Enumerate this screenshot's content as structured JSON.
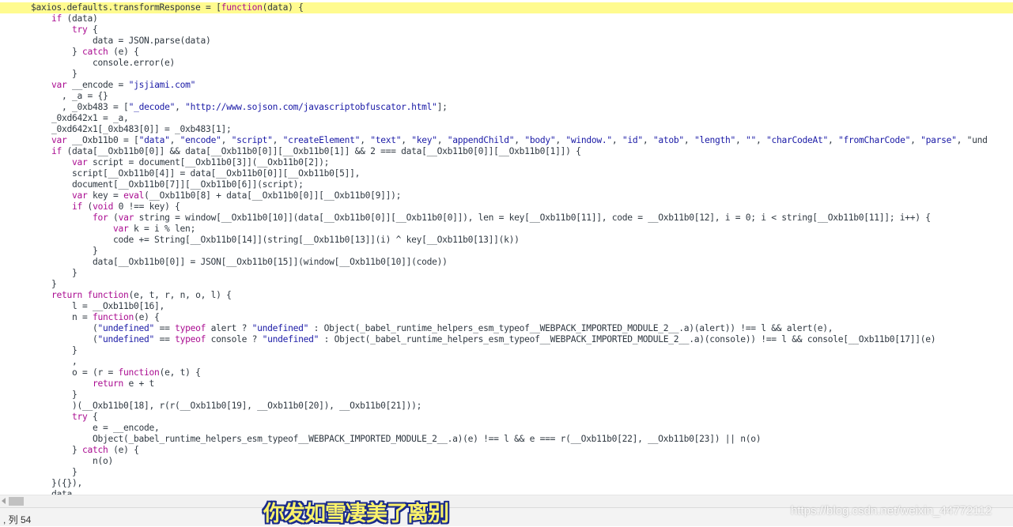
{
  "editor": {
    "lines": [
      {
        "indent": "      ",
        "text": "$axios.defaults.transformResponse = [function(data) {",
        "highlight": true
      },
      {
        "indent": "          ",
        "text": "if (data)"
      },
      {
        "indent": "              ",
        "text": "try {"
      },
      {
        "indent": "                  ",
        "text": "data = JSON.parse(data)"
      },
      {
        "indent": "              ",
        "text": "} catch (e) {"
      },
      {
        "indent": "                  ",
        "text": "console.error(e)"
      },
      {
        "indent": "              ",
        "text": "}"
      },
      {
        "indent": "          ",
        "text": "var __encode = \"jsjiami.com\""
      },
      {
        "indent": "            ",
        "text": ", _a = {}"
      },
      {
        "indent": "            ",
        "text": ", _0xb483 = [\"_decode\", \"http://www.sojson.com/javascriptobfuscator.html\"];"
      },
      {
        "indent": "          ",
        "text": "_0xd642x1 = _a,"
      },
      {
        "indent": "          ",
        "text": "_0xd642x1[_0xb483[0]] = _0xb483[1];"
      },
      {
        "indent": "          ",
        "text": "var __Oxb11b0 = [\"data\", \"encode\", \"script\", \"createElement\", \"text\", \"key\", \"appendChild\", \"body\", \"window.\", \"id\", \"atob\", \"length\", \"\", \"charCodeAt\", \"fromCharCode\", \"parse\", \"und"
      },
      {
        "indent": "          ",
        "text": "if (data[__Oxb11b0[0]] && data[__Oxb11b0[0]][__Oxb11b0[1]] && 2 === data[__Oxb11b0[0]][__Oxb11b0[1]]) {"
      },
      {
        "indent": "              ",
        "text": "var script = document[__Oxb11b0[3]](__Oxb11b0[2]);"
      },
      {
        "indent": "              ",
        "text": "script[__Oxb11b0[4]] = data[__Oxb11b0[0]][__Oxb11b0[5]],"
      },
      {
        "indent": "              ",
        "text": "document[__Oxb11b0[7]][__Oxb11b0[6]](script);"
      },
      {
        "indent": "              ",
        "text": "var key = eval(__Oxb11b0[8] + data[__Oxb11b0[0]][__Oxb11b0[9]]);"
      },
      {
        "indent": "              ",
        "text": "if (void 0 !== key) {"
      },
      {
        "indent": "                  ",
        "text": "for (var string = window[__Oxb11b0[10]](data[__Oxb11b0[0]][__Oxb11b0[0]]), len = key[__Oxb11b0[11]], code = __Oxb11b0[12], i = 0; i < string[__Oxb11b0[11]]; i++) {"
      },
      {
        "indent": "                      ",
        "text": "var k = i % len;"
      },
      {
        "indent": "                      ",
        "text": "code += String[__Oxb11b0[14]](string[__Oxb11b0[13]](i) ^ key[__Oxb11b0[13]](k))"
      },
      {
        "indent": "                  ",
        "text": "}"
      },
      {
        "indent": "                  ",
        "text": "data[__Oxb11b0[0]] = JSON[__Oxb11b0[15]](window[__Oxb11b0[10]](code))"
      },
      {
        "indent": "              ",
        "text": "}"
      },
      {
        "indent": "          ",
        "text": "}"
      },
      {
        "indent": "          ",
        "text": "return function(e, t, r, n, o, l) {"
      },
      {
        "indent": "              ",
        "text": "l = __Oxb11b0[16],"
      },
      {
        "indent": "              ",
        "text": "n = function(e) {"
      },
      {
        "indent": "                  ",
        "text": "(\"undefined\" == typeof alert ? \"undefined\" : Object(_babel_runtime_helpers_esm_typeof__WEBPACK_IMPORTED_MODULE_2__.a)(alert)) !== l && alert(e),"
      },
      {
        "indent": "                  ",
        "text": "(\"undefined\" == typeof console ? \"undefined\" : Object(_babel_runtime_helpers_esm_typeof__WEBPACK_IMPORTED_MODULE_2__.a)(console)) !== l && console[__Oxb11b0[17]](e)"
      },
      {
        "indent": "              ",
        "text": "}"
      },
      {
        "indent": "              ",
        "text": ","
      },
      {
        "indent": "              ",
        "text": "o = (r = function(e, t) {"
      },
      {
        "indent": "                  ",
        "text": "return e + t"
      },
      {
        "indent": "              ",
        "text": "}"
      },
      {
        "indent": "              ",
        "text": ")(__Oxb11b0[18], r(r(__Oxb11b0[19], __Oxb11b0[20]), __Oxb11b0[21]));"
      },
      {
        "indent": "              ",
        "text": "try {"
      },
      {
        "indent": "                  ",
        "text": "e = __encode,"
      },
      {
        "indent": "                  ",
        "text": "Object(_babel_runtime_helpers_esm_typeof__WEBPACK_IMPORTED_MODULE_2__.a)(e) !== l && e === r(__Oxb11b0[22], __Oxb11b0[23]) || n(o)"
      },
      {
        "indent": "              ",
        "text": "} catch (e) {"
      },
      {
        "indent": "                  ",
        "text": "n(o)"
      },
      {
        "indent": "              ",
        "text": "}"
      },
      {
        "indent": "          ",
        "text": "}({}),"
      },
      {
        "indent": "          ",
        "text": "data"
      }
    ]
  },
  "statusbar": {
    "position": ", 列 54"
  },
  "overlay": {
    "subtitle": "你发如雪凄美了离别",
    "watermark": "https://blog.csdn.net/weixin_44772112"
  },
  "colors": {
    "highlight_line": "#fffb8f",
    "keyword": "#aa0d91",
    "string": "#1a1aa6",
    "subtitle_fill": "#fbf26a",
    "subtitle_outline": "#1a2b8a"
  }
}
